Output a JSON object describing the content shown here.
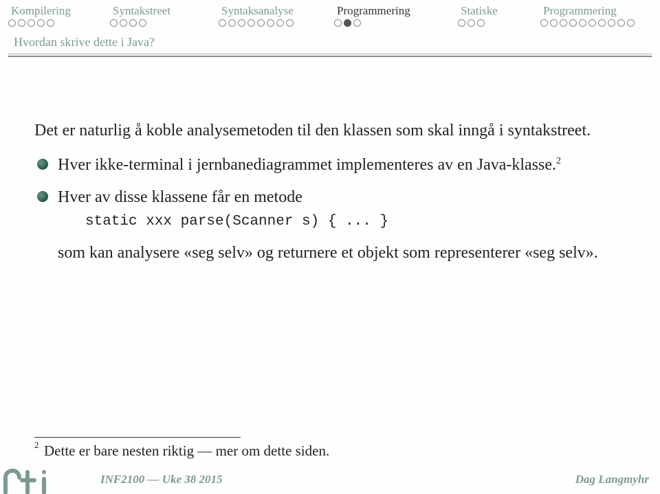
{
  "nav": {
    "items": [
      {
        "label": "Kompilering",
        "dots": 5,
        "filled": []
      },
      {
        "label": "Syntakstreet",
        "dots": 4,
        "filled": []
      },
      {
        "label": "Syntaksanalyse",
        "dots": 8,
        "filled": []
      },
      {
        "label": "Programmering",
        "dots": 3,
        "filled": [
          1
        ]
      },
      {
        "label": "Statiske",
        "dots": 3,
        "filled": []
      },
      {
        "label": "Programmering",
        "dots": 10,
        "filled": []
      }
    ]
  },
  "subtitle": "Hvordan skrive dette i Java?",
  "content": {
    "intro": "Det er naturlig å koble analysemetoden til den klassen som skal inngå i syntakstreet.",
    "bullets": [
      {
        "text_before_sup": "Hver ikke-terminal i jernbanediagrammet implementeres av en Java-klasse.",
        "sup": "2"
      },
      {
        "text": "Hver av disse klassene får en metode",
        "code": "static xxx parse(Scanner s) { ... }",
        "after": "som kan analysere «seg selv» og returnere et objekt som representerer «seg selv»."
      }
    ]
  },
  "footnote": {
    "num": "2",
    "text": "Dette er bare nesten riktig — mer om dette siden."
  },
  "footer": {
    "course": "INF2100 — Uke 38 2015",
    "author": "Dag Langmyhr"
  }
}
